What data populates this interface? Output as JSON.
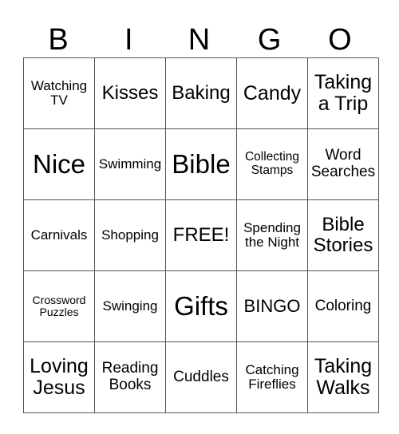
{
  "header": [
    "B",
    "I",
    "N",
    "G",
    "O"
  ],
  "rows": [
    [
      "Watching TV",
      "Kisses",
      "Baking",
      "Candy",
      "Taking a Trip"
    ],
    [
      "Nice",
      "Swimming",
      "Bible",
      "Collecting Stamps",
      "Word Searches"
    ],
    [
      "Carnivals",
      "Shopping",
      "FREE!",
      "Spending the Night",
      "Bible Stories"
    ],
    [
      "Crossword Puzzles",
      "Swinging",
      "Gifts",
      "BINGO",
      "Coloring"
    ],
    [
      "Loving Jesus",
      "Reading Books",
      "Cuddles",
      "Catching Fireflies",
      "Taking Walks"
    ]
  ]
}
